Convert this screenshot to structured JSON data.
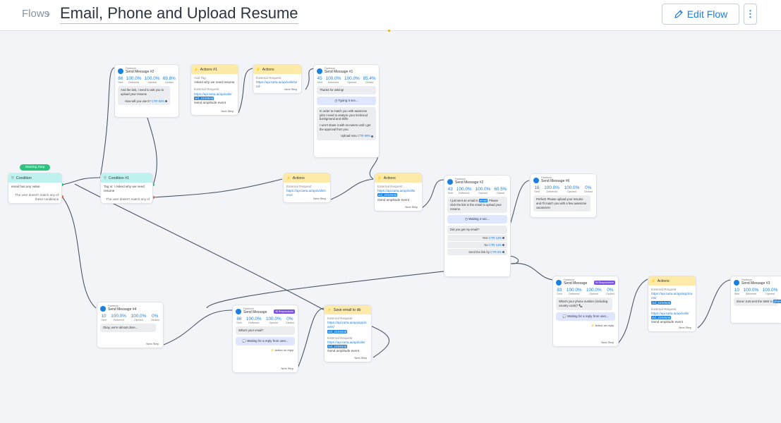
{
  "header": {
    "breadcrumb_root": "Flows",
    "breadcrumb_sep": "›",
    "title": "Email, Phone and Upload Resume",
    "edit_label": "Edit Flow",
    "more_label": "⋮"
  },
  "colors": {
    "accent": "#1a7fe0",
    "start": "#2ec27e",
    "action_header": "#fde9a8",
    "condition_header": "#bff2ef",
    "badge": "#7a4ee0"
  },
  "start": {
    "label": "Starting Step"
  },
  "cond0": {
    "title": "Condition",
    "rule": "email has any value",
    "else": "The user doesn't match any of these conditions"
  },
  "cond1": {
    "title": "Condition #1",
    "rule": "Tag is: ! Asked why we need resume",
    "else": "The user doesn't match any of these conditions"
  },
  "stat_labels": {
    "sent": "Sent",
    "delivered": "Delivered",
    "opened": "Opened",
    "clicked": "Clicked"
  },
  "common": {
    "facebook": "Facebook",
    "next_step": "Next Step",
    "action_on_reply": "Action on reply",
    "external_request": "External Request",
    "amplitude": "/send amplitude event"
  },
  "sm2a": {
    "name": "Send Message #2",
    "sent": "86",
    "delivered": "100.0%",
    "opened": "100.0%",
    "clicked": "69.8%",
    "text": "And the last, I need to ask you to upload your resume",
    "btn": "How will you use it?",
    "ctr": "CTR 83%"
  },
  "act1": {
    "title": "Actions #1",
    "add_tag": "Add Tag",
    "tag": "Asked why we need resume",
    "url": "https://api.tarta.ai/api/utils/",
    "code": "cid_223453d",
    "amp": "/send amplitude event"
  },
  "act2": {
    "title": "Actions",
    "url": "https://api.tarta.ai/api/utils/send-"
  },
  "sm1": {
    "name": "Send Message #1",
    "sent": "45",
    "delivered": "100.0%",
    "opened": "100.0%",
    "clicked": "85.4%",
    "text1": "Thanks for asking!",
    "typing": "Typing 3 sec...",
    "text2": "In order to match you with awesome jobs I need to analyze your technical background and skills.",
    "text3": "I won't share it with recruiters until I get the approval from you.",
    "btn": "Upload resu",
    "ctr": "CTR 59%"
  },
  "act3": {
    "title": "Actions",
    "url": "https://api.tarta.ai/api/utils/send-"
  },
  "act4": {
    "title": "Actions",
    "url": "https://api.tarta.ai/api/utils/",
    "code": "cid_223453d",
    "amp": "/send amplitude event"
  },
  "sm2b": {
    "name": "Send Message #2",
    "sent": "43",
    "delivered": "100.0%",
    "opened": "100.0%",
    "clicked": "60.5%",
    "text1a": "I just sent an email to",
    "text1tag": "email",
    "text1b": ". Please click the link in the email to upload your resume.",
    "waiting": "Waiting 4 sec...",
    "q": "Did you get my email?",
    "yes": "Yes!",
    "yes_ctr": "CTR 12%",
    "no": "No",
    "no_ctr": "CTR 14%",
    "sms": "Send the link by",
    "sms_ctr": "CTR 5%"
  },
  "sm6": {
    "name": "Send Message #6",
    "sent": "16",
    "delivered": "100.0%",
    "opened": "100.0%",
    "clicked": "0%",
    "text": "Perfect! Please upload your resume and I'll match you with a few awesome vacancies!"
  },
  "sm4": {
    "name": "Send Message #4",
    "sent": "10",
    "delivered": "100.0%",
    "opened": "100.0%",
    "clicked": "0%",
    "text": "Okay, we're almost done..."
  },
  "sme": {
    "name": "Send Message",
    "badge": "45 Respondents",
    "sent": "86",
    "delivered": "100.0%",
    "opened": "100.0%",
    "clicked": "0%",
    "text": "What's your email?",
    "waiting": "Waiting for a reply from user..."
  },
  "save": {
    "title": "Save email to db",
    "url1": "https://api.tarta.ai/api/applicants/",
    "code1": "cid_223453d",
    "url2": "https://api.tarta.ai/api/utils/",
    "code2": "cid_223453d",
    "amp": "/send amplitude event"
  },
  "smp": {
    "name": "Send Message",
    "badge": "64 Respondents",
    "sent": "83",
    "delivered": "100.0%",
    "opened": "100.0%",
    "clicked": "0%",
    "text": "What's your phone number (including country code)? 📞",
    "waiting": "Waiting for a reply from user..."
  },
  "act5": {
    "title": "Actions",
    "url1": "https://api.tarta.ai/api/applicants/",
    "code1": "cid_223453d",
    "url2": "https://api.tarta.ai/api/utils/",
    "code2": "cid_223453d",
    "amp": "/send amplitude event"
  },
  "sm3": {
    "name": "Send Message #3",
    "sent": "10",
    "delivered": "100.0%",
    "opened": "100.0%",
    "text": "Done! Just sent the SMS to",
    "tag": "phone"
  }
}
